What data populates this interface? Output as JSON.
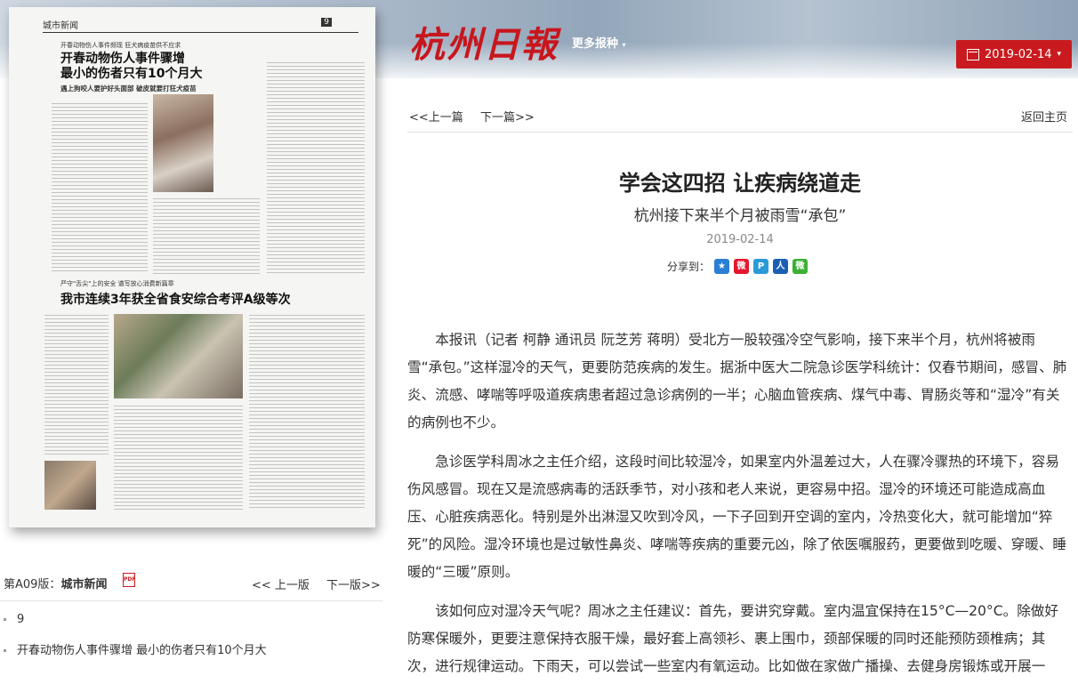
{
  "header": {
    "logo_text": "杭州日報",
    "more_papers": "更多报种",
    "date": "2019-02-14"
  },
  "newspaper": {
    "section": "城市新闻",
    "page_no": "9",
    "kicker1": "开春动物伤人事件频现 狂犬病疫苗供不应求",
    "headline1a": "开春动物伤人事件骤增",
    "headline1b": "最小的伤者只有10个月大",
    "subhead1": "遇上狗咬人要护好头面部 破皮就要打狂犬疫苗",
    "kicker2": "严守\"舌尖\"上的安全 谱写放心消费新篇章",
    "headline2": "我市连续3年获全省食安综合考评A级等次"
  },
  "page_info": {
    "label_prefix": "第A09版：",
    "label_name": "城市新闻",
    "pdf_icon": "pdf-icon",
    "prev": "<< 上一版",
    "next": "下一版>>"
  },
  "page_list": [
    "9",
    "开春动物伤人事件骤增 最小的伤者只有10个月大"
  ],
  "article_nav": {
    "prev": "<<上一篇",
    "next": "下一篇>>",
    "home": "返回主页"
  },
  "article": {
    "title": "学会这四招 让疾病绕道走",
    "subtitle": "杭州接下来半个月被雨雪“承包”",
    "date": "2019-02-14",
    "share_label": "分享到：",
    "paragraphs": [
      "本报讯（记者 柯静 通讯员 阮芝芳 蒋明）受北方一股较强冷空气影响，接下来半个月，杭州将被雨雪“承包。”这样湿冷的天气，更要防范疾病的发生。据浙中医大二院急诊医学科统计：仅春节期间，感冒、肺炎、流感、哮喘等呼吸道疾病患者超过急诊病例的一半；心脑血管疾病、煤气中毒、胃肠炎等和“湿冷”有关的病例也不少。",
      "急诊医学科周冰之主任介绍，这段时间比较湿冷，如果室内外温差过大，人在骤冷骤热的环境下，容易伤风感冒。现在又是流感病毒的活跃季节，对小孩和老人来说，更容易中招。湿冷的环境还可能造成高血压、心脏疾病恶化。特别是外出淋湿又吹到冷风，一下子回到开空调的室内，冷热变化大，就可能增加“猝死”的风险。湿冷环境也是过敏性鼻炎、哮喘等疾病的重要元凶，除了依医嘱服药，更要做到吃暖、穿暖、睡暖的“三暖”原则。",
      "该如何应对湿冷天气呢？周冰之主任建议：首先，要讲究穿戴。室内温宜保持在15°C—20°C。除做好防寒保暖外，更要注意保持衣服干燥，最好套上高领衫、裹上围巾，颈部保暖的同时还能预防颈椎病；其次，进行规律运动。下雨天，可以尝试一些室内有氧运动。比如做在家做广播操、去健身房锻炼或开展一"
    ]
  }
}
